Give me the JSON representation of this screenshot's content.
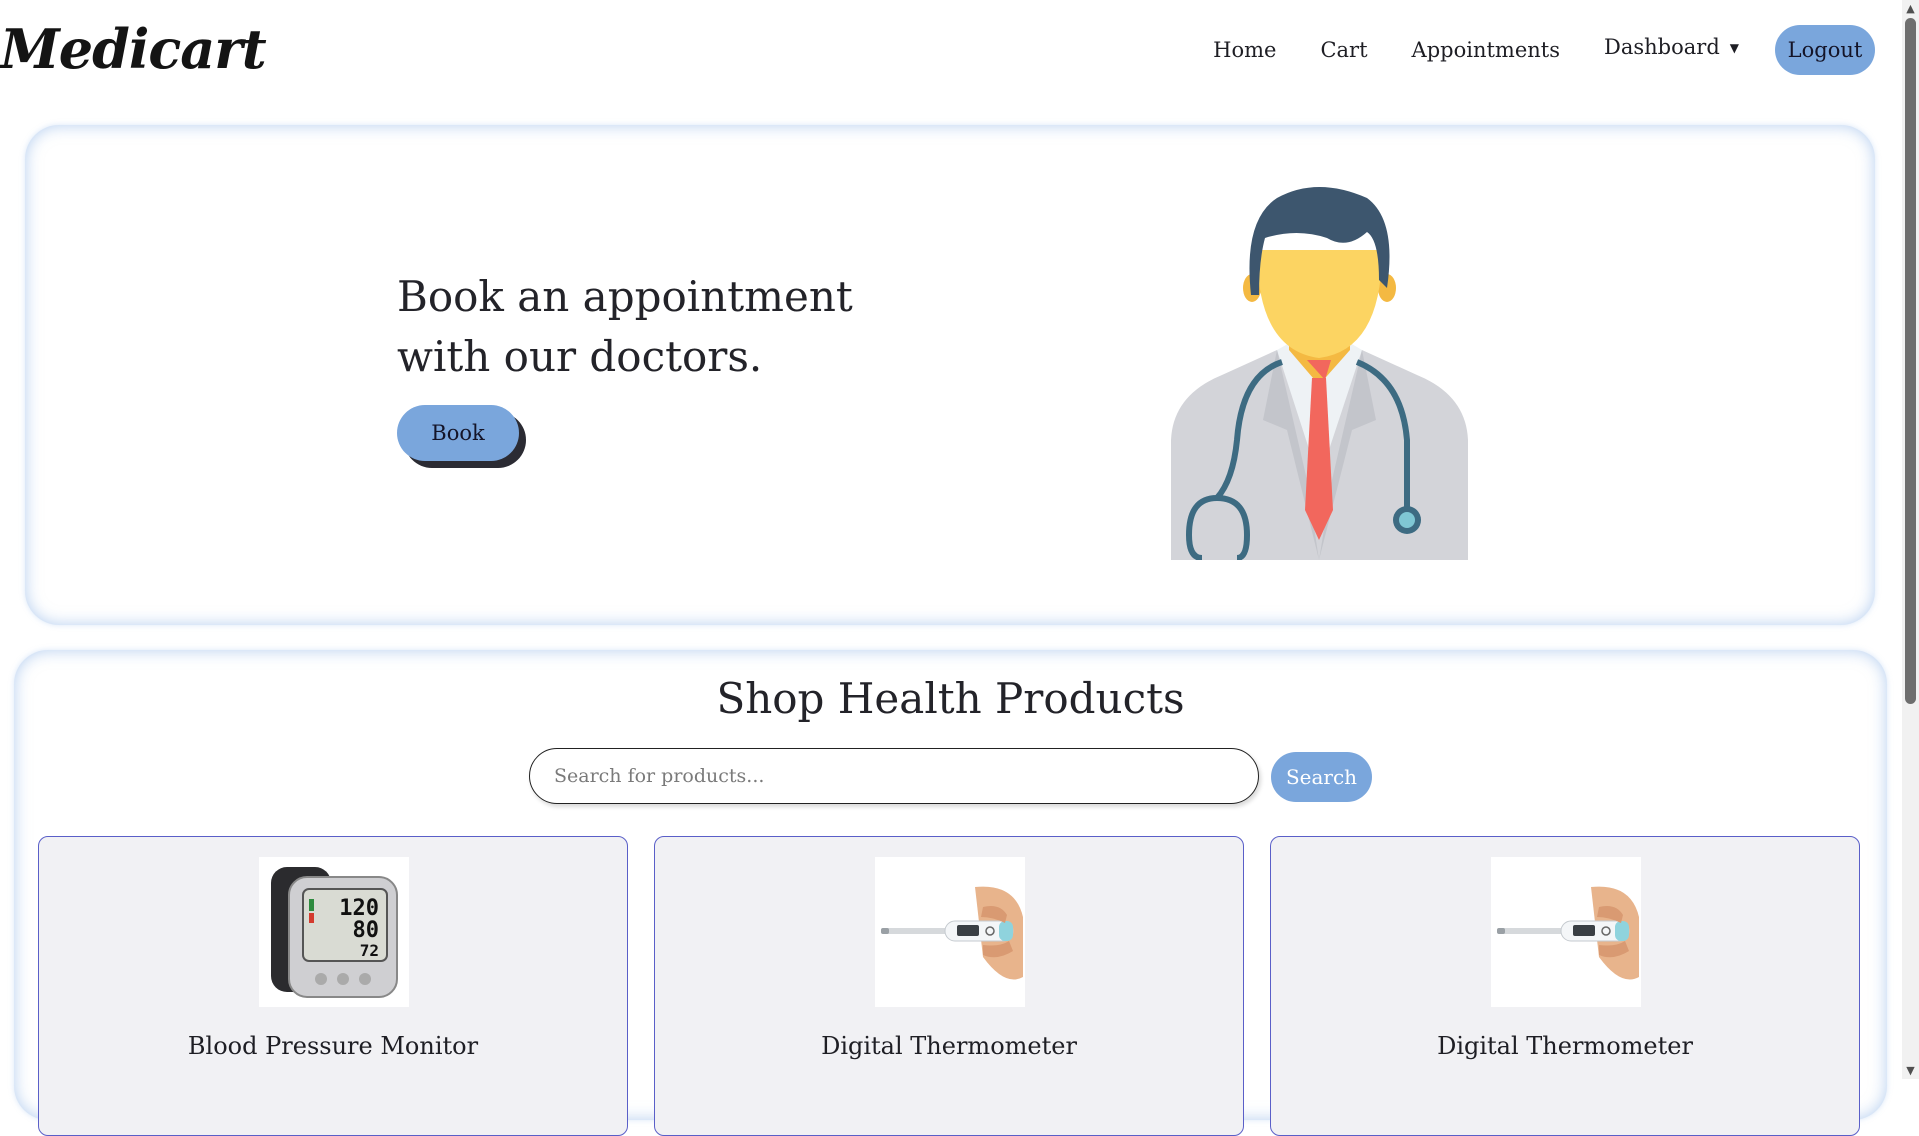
{
  "header": {
    "logo": "Medicart",
    "nav": [
      "Home",
      "Cart",
      "Appointments"
    ],
    "dashboard_label": "Dashboard",
    "dashboard_arrow": "▼",
    "logout_label": "Logout"
  },
  "hero": {
    "title_line1": "Book an appointment",
    "title_line2": "with our doctors.",
    "book_label": "Book",
    "illustration": "doctor-with-stethoscope"
  },
  "shop": {
    "title": "Shop Health Products",
    "search_placeholder": "Search for products...",
    "search_value": "",
    "search_label": "Search",
    "products": [
      {
        "name": "Blood Pressure Monitor",
        "image": "blood-pressure-monitor"
      },
      {
        "name": "Digital Thermometer",
        "image": "digital-thermometer"
      },
      {
        "name": "Digital Thermometer",
        "image": "digital-thermometer"
      }
    ]
  },
  "colors": {
    "accent": "#7aa6dc",
    "card_border": "#5a5fc8",
    "card_bg": "#f1f1f4",
    "text": "#1e1e24"
  }
}
